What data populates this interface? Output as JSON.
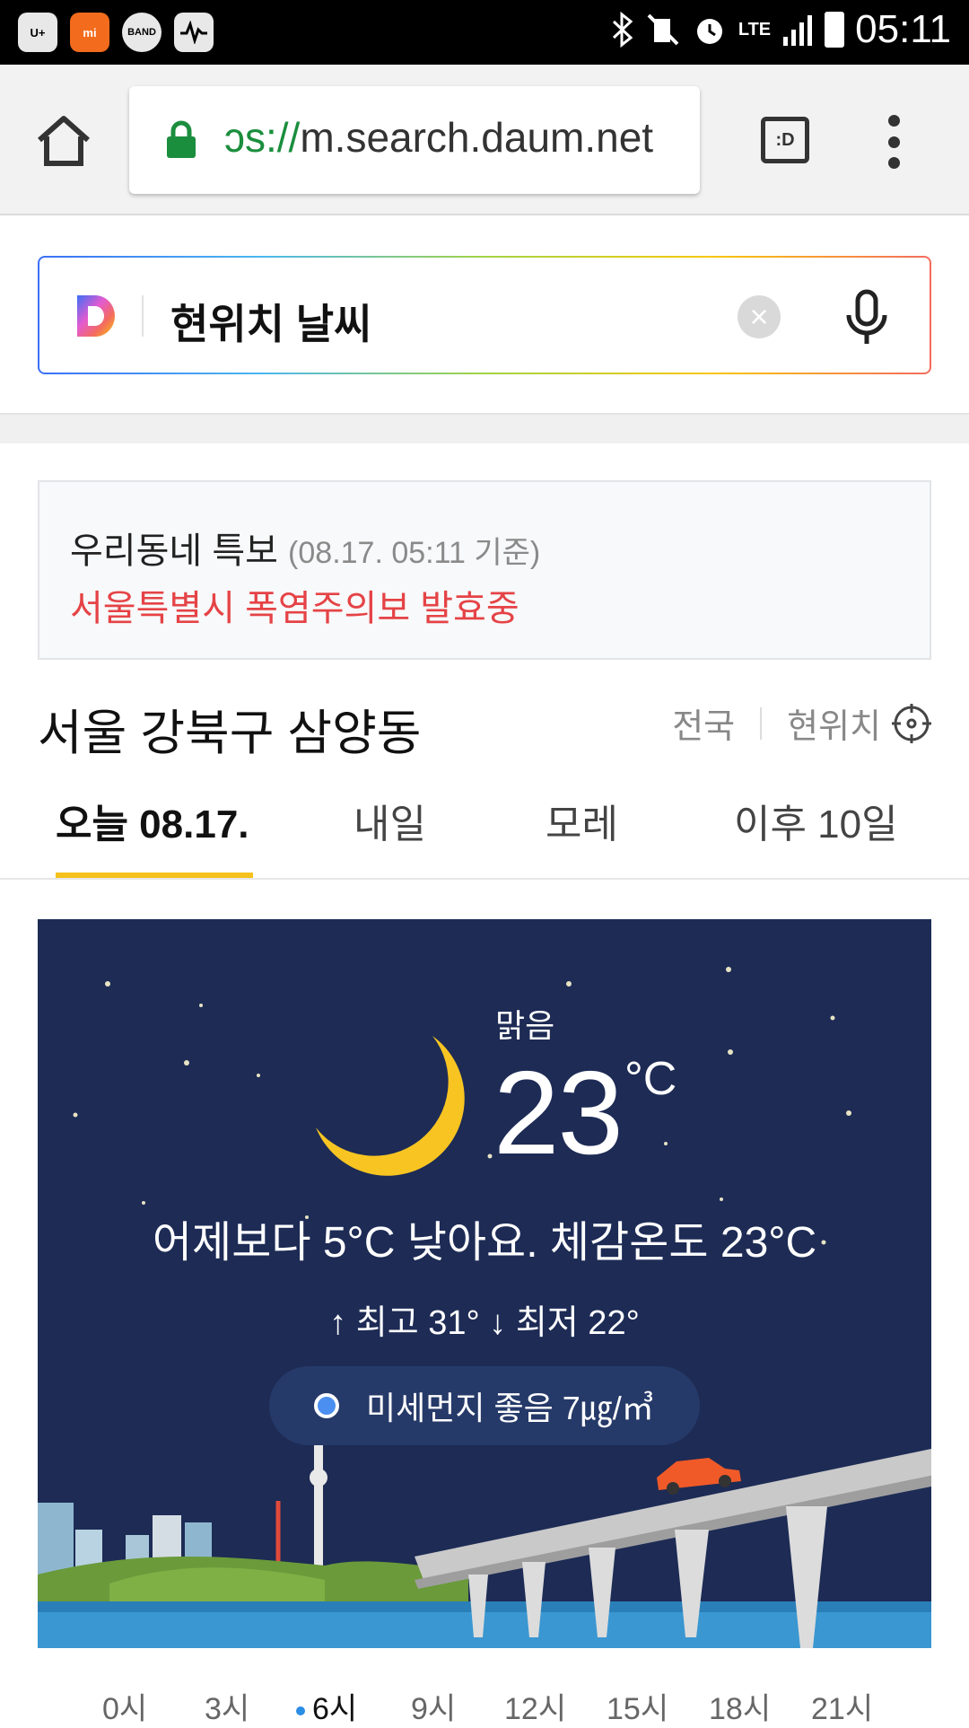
{
  "status_bar": {
    "app_icons": [
      "U+",
      "mi",
      "BAND"
    ],
    "network": "LTE",
    "time": "05:11"
  },
  "browser": {
    "url_scheme_fragment": "ɔs://",
    "url_host": "m.search.daum.net",
    "tabs_button_label": ":D"
  },
  "search": {
    "query": "현위치 날씨"
  },
  "alert": {
    "heading": "우리동네 특보",
    "timestamp": "(08.17. 05:11 기준)",
    "message": "서울특별시 폭염주의보 발효중"
  },
  "location": {
    "name": "서울 강북구 삼양동",
    "nationwide_label": "전국",
    "current_location_label": "현위치"
  },
  "day_tabs": [
    {
      "label": "오늘 08.17.",
      "active": true
    },
    {
      "label": "내일",
      "active": false
    },
    {
      "label": "모레",
      "active": false
    },
    {
      "label": "이후 10일",
      "active": false
    }
  ],
  "weather": {
    "condition": "맑음",
    "temperature": "23",
    "unit": "°C",
    "comparison": "어제보다 5°C 낮아요. 체감온도 23°C",
    "high_low": "↑ 최고 31° ↓ 최저 22°",
    "fine_dust": "미세먼지 좋음 7㎍/㎥"
  },
  "hourly": [
    {
      "label": "0시",
      "active": false
    },
    {
      "label": "3시",
      "active": false
    },
    {
      "label": "6시",
      "active": true
    },
    {
      "label": "9시",
      "active": false
    },
    {
      "label": "12시",
      "active": false
    },
    {
      "label": "15시",
      "active": false
    },
    {
      "label": "18시",
      "active": false
    },
    {
      "label": "21시",
      "active": false
    }
  ],
  "colors": {
    "card_background": "#1d2b55",
    "moon": "#f7c422",
    "alert_text": "#e54346",
    "tab_underline": "#f6c11b",
    "lock": "#1b8e3e",
    "active_hour_dot": "#2a8de6"
  },
  "icons": [
    "home-icon",
    "lock-icon",
    "tabs-icon",
    "more-vert-icon",
    "daum-logo",
    "clear-icon",
    "microphone-icon",
    "crosshair-icon",
    "moon-icon",
    "fine-dust-dot"
  ]
}
